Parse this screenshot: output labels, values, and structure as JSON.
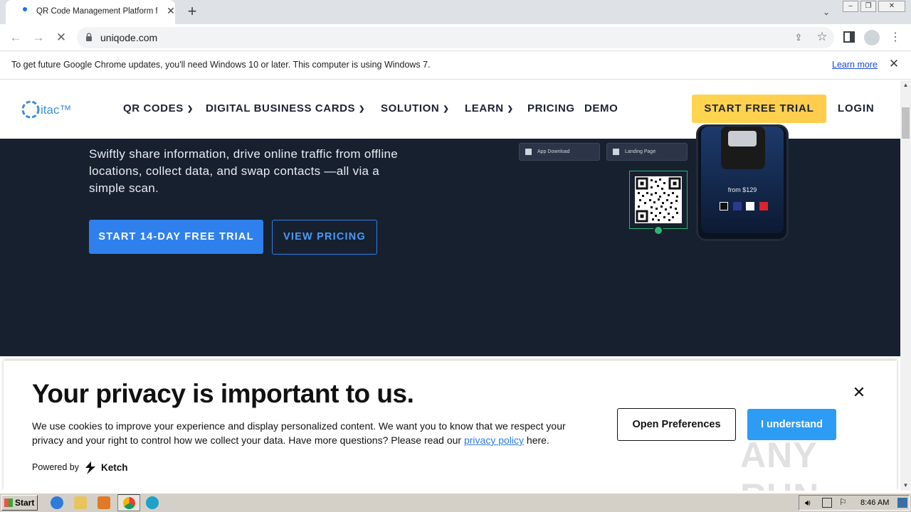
{
  "browser": {
    "tab_title": "QR Code Management Platform for m",
    "url": "uniqode.com",
    "infobar_text": "To get future Google Chrome updates, you'll need Windows 10 or later. This computer is using Windows 7.",
    "infobar_link": "Learn more"
  },
  "site": {
    "logo": "itac™",
    "nav": [
      "QR CODES",
      "DIGITAL BUSINESS CARDS",
      "SOLUTION",
      "LEARN",
      "PRICING",
      "DEMO"
    ],
    "cta": "START FREE TRIAL",
    "login": "LOGIN"
  },
  "hero": {
    "text": "Swiftly share information, drive online traffic from offline locations, collect data, and swap contacts —all via a simple scan.",
    "primary_button": "START 14-DAY FREE TRIAL",
    "secondary_button": "VIEW PRICING",
    "chip_app": "App Download",
    "chip_landing": "Landing Page",
    "phone_price": "from $129",
    "swatches": [
      "#111111",
      "#2b3a8f",
      "#ffffff",
      "#d9242b"
    ]
  },
  "privacy": {
    "title": "Your privacy is important to us.",
    "body_start": "We use cookies to improve your experience and display personalized content. We want you to know that we respect your privacy and your right to control how we collect your data. Have more questions? Please read our ",
    "link": "privacy policy",
    "body_end": " here.",
    "powered_by": "Powered by",
    "ketch": "Ketch",
    "prefs_button": "Open Preferences",
    "ok_button": "I understand",
    "watermark": "ANY RUN"
  },
  "taskbar": {
    "start": "Start",
    "clock": "8:46 AM"
  }
}
